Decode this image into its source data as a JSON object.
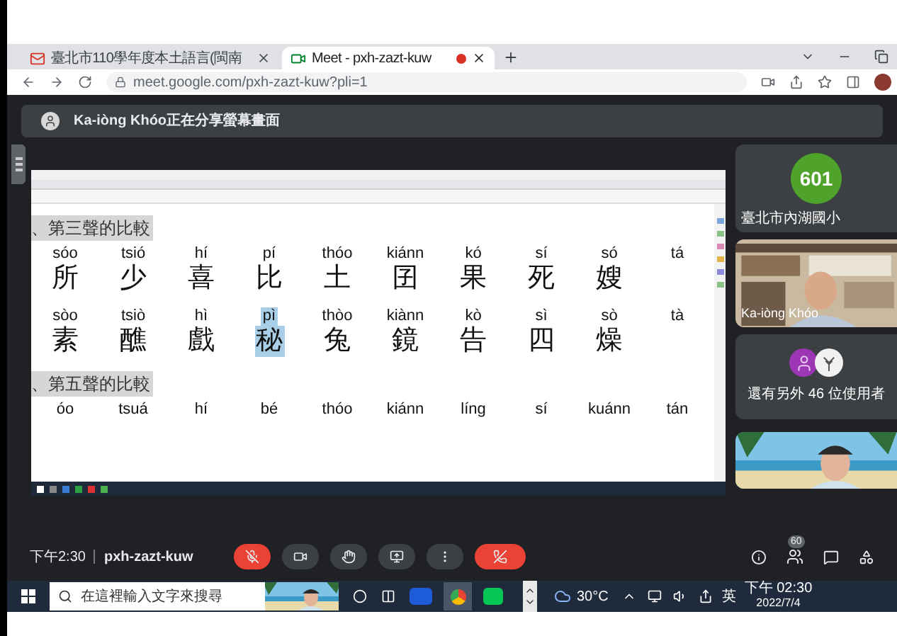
{
  "browser": {
    "tabs": [
      {
        "title": "臺北市110學年度本土語言(閩南",
        "selected": false
      },
      {
        "title": "Meet - pxh-zazt-kuw",
        "selected": true
      }
    ],
    "url": "meet.google.com/pxh-zazt-kuw?pli=1"
  },
  "banner": {
    "text": "Ka-iòng Khóo正在分享螢幕畫面"
  },
  "document": {
    "sections": [
      {
        "heading": "、第三聲的比較",
        "rows": [
          {
            "cells": [
              {
                "roman": "sóo",
                "char": "所",
                "selected": false
              },
              {
                "roman": "tsió",
                "char": "少",
                "selected": false
              },
              {
                "roman": "hí",
                "char": "喜",
                "selected": false
              },
              {
                "roman": "pí",
                "char": "比",
                "selected": false
              },
              {
                "roman": "thóo",
                "char": "土",
                "selected": false
              },
              {
                "roman": "kiánn",
                "char": "囝",
                "selected": false
              },
              {
                "roman": "kó",
                "char": "果",
                "selected": false
              },
              {
                "roman": "sí",
                "char": "死",
                "selected": false
              },
              {
                "roman": "só",
                "char": "嫂",
                "selected": false
              },
              {
                "roman": "tá",
                "selected": false
              }
            ]
          },
          {
            "cells": [
              {
                "roman": "sòo",
                "char": "素",
                "selected": false
              },
              {
                "roman": "tsiò",
                "char": "醮",
                "selected": false
              },
              {
                "roman": "hì",
                "char": "戲",
                "selected": false
              },
              {
                "roman": "pì",
                "char": "秘",
                "selected": true
              },
              {
                "roman": "thòo",
                "char": "兔",
                "selected": false
              },
              {
                "roman": "kiànn",
                "char": "鏡",
                "selected": false
              },
              {
                "roman": "kò",
                "char": "告",
                "selected": false
              },
              {
                "roman": "sì",
                "char": "四",
                "selected": false
              },
              {
                "roman": "sò",
                "char": "燥",
                "selected": false
              },
              {
                "roman": "tà",
                "selected": false
              }
            ]
          }
        ]
      },
      {
        "heading": "、第五聲的比較",
        "rows": [
          {
            "cells": [
              {
                "roman": "óo",
                "selected": false
              },
              {
                "roman": "tsuá",
                "selected": false
              },
              {
                "roman": "hí",
                "selected": false
              },
              {
                "roman": "bé",
                "selected": false
              },
              {
                "roman": "thóo",
                "selected": false
              },
              {
                "roman": "kiánn",
                "selected": false
              },
              {
                "roman": "líng",
                "selected": false
              },
              {
                "roman": "sí",
                "selected": false
              },
              {
                "roman": "kuánn",
                "selected": false
              },
              {
                "roman": "tán",
                "selected": false
              }
            ]
          }
        ]
      }
    ]
  },
  "participants": [
    {
      "kind": "logo",
      "logo_text": "601",
      "name": "臺北市內湖國小"
    },
    {
      "kind": "video",
      "name": "Ka-iòng Khóo"
    },
    {
      "kind": "others",
      "text": "還有另外 46 位使用者"
    },
    {
      "kind": "video"
    }
  ],
  "meeting_bar": {
    "time": "下午2:30",
    "code": "pxh-zazt-kuw",
    "mic_muted": true,
    "people_count": "60"
  },
  "taskbar": {
    "search_placeholder": "在這裡輸入文字來搜尋",
    "temperature": "30°C",
    "ime": "英",
    "time": "下午 02:30",
    "date": "2022/7/4"
  }
}
